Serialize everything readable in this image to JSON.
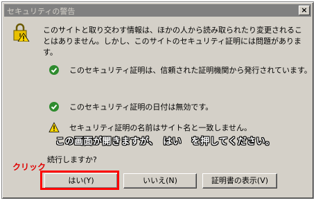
{
  "window": {
    "title": "セキュリティの警告",
    "close_glyph": "×"
  },
  "intro_text": "このサイトと取り交わす情報は、ほかの人から読み取られたり変更されることはありません。しかし、このサイトのセキュリティ証明には問題があります。",
  "checks": [
    {
      "icon": "check-icon",
      "status": "ok",
      "text": "このセキュリティ証明は、信頼された証明機関から発行されています。"
    },
    {
      "icon": "check-icon",
      "status": "ok",
      "text": "このセキュリティ証明の日付は無効です。"
    },
    {
      "icon": "warning-icon",
      "status": "warning",
      "text": "セキュリティ証明の名前はサイト名と一致しません。"
    }
  ],
  "annotation": "この画面が開きますが、　はい　を押してください。",
  "question": "続行しますか?",
  "click_label": "クリック",
  "buttons": {
    "yes": "はい(Y)",
    "no": "いいえ(N)",
    "view_cert": "証明書の表示(V)"
  },
  "colors": {
    "dialog_bg": "#d4d0c8",
    "titlebar_bg": "#808080",
    "check_green": "#2e8b2e",
    "warning_yellow": "#ffd800",
    "highlight_red": "#ff0000"
  }
}
